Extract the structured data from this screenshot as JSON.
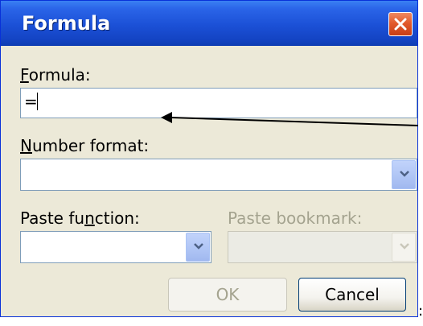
{
  "window": {
    "title": "Formula"
  },
  "fields": {
    "formula_label_accel": "F",
    "formula_label_rest": "ormula:",
    "formula_value": "=",
    "number_format_label_accel": "N",
    "number_format_label_rest": "umber format:",
    "number_format_value": "",
    "paste_function_label_pre": "Paste fu",
    "paste_function_label_accel": "n",
    "paste_function_label_post": "ction:",
    "paste_function_value": "",
    "paste_bookmark_label": "Paste bookmark:",
    "paste_bookmark_value": ""
  },
  "buttons": {
    "ok": "OK",
    "cancel": "Cancel"
  },
  "extra": {
    "stray_colon": ":"
  },
  "icons": {
    "close": "close-icon",
    "dropdown": "chevron-down-icon"
  },
  "colors": {
    "title_bar": "#1b50d6",
    "dialog_bg": "#ece9d8",
    "close_button": "#e25a2c"
  }
}
